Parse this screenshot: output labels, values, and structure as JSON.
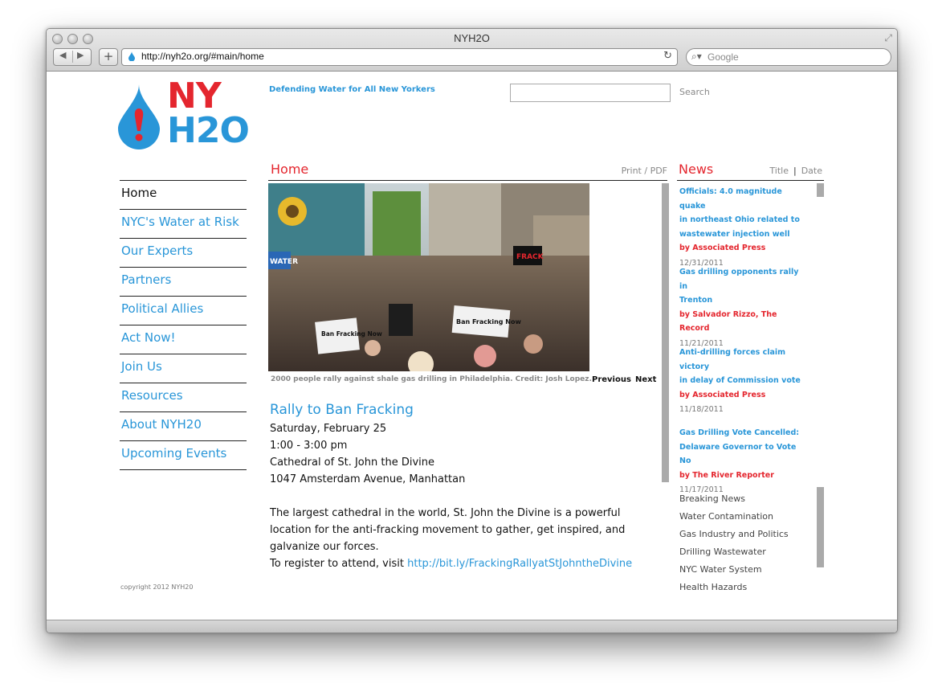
{
  "browser": {
    "window_title": "NYH2O",
    "url": "http://nyh2o.org/#main/home",
    "search_placeholder": "Google"
  },
  "site": {
    "logo_line1": "NY",
    "logo_line2": "H2O",
    "tagline": "Defending Water for All New Yorkers",
    "search_label": "Search",
    "copyright": "copyright 2012 NYH20"
  },
  "nav": {
    "items": [
      {
        "label": "Home"
      },
      {
        "label": "NYC's Water at Risk"
      },
      {
        "label": "Our Experts"
      },
      {
        "label": "Partners"
      },
      {
        "label": "Political Allies"
      },
      {
        "label": "Act Now!"
      },
      {
        "label": "Join Us"
      },
      {
        "label": "Resources"
      },
      {
        "label": "About NYH20"
      },
      {
        "label": "Upcoming Events"
      }
    ]
  },
  "main": {
    "section_title": "Home",
    "print_label": "Print / PDF",
    "photo_caption": "2000 people rally against shale gas drilling in Philadelphia. Credit: Josh Lopez.",
    "previous_label": "Previous",
    "next_label": "Next",
    "event_title": "Rally to Ban Fracking",
    "event_lines": [
      "Saturday, February 25",
      "1:00 - 3:00 pm",
      "Cathedral of St. John the Divine",
      "1047 Amsterdam Avenue, Manhattan"
    ],
    "description_lines": [
      "The largest cathedral in the world, St. John the Divine is a powerful",
      "location for the anti-fracking movement to gather, get inspired, and",
      "galvanize our forces."
    ],
    "register_text": "To register to attend, visit ",
    "register_link": "http://bit.ly/FrackingRallyatStJohntheDivine",
    "sign_texts": [
      "Ban Fracking Now",
      "Ban Fracking Now",
      "FRACK",
      "WATER"
    ]
  },
  "news": {
    "title": "News",
    "sort_title": "Title",
    "sort_sep": "|",
    "sort_date": "Date",
    "items": [
      {
        "headline_lines": [
          "Officials: 4.0 magnitude quake",
          "in northeast Ohio related to",
          "wastewater injection well"
        ],
        "byline": "by Associated Press",
        "date": "12/31/2011"
      },
      {
        "headline_lines": [
          "Gas drilling opponents rally in",
          "Trenton"
        ],
        "byline": "by Salvador Rizzo, The Record",
        "date": "11/21/2011"
      },
      {
        "headline_lines": [
          "Anti-drilling forces claim victory",
          "in delay of Commission vote"
        ],
        "byline": "by Associated Press",
        "date": "11/18/2011"
      },
      {
        "headline_lines": [
          "Gas Drilling Vote Cancelled:",
          "Delaware Governor to Vote No"
        ],
        "byline": "by The River Reporter",
        "date": "11/17/2011"
      }
    ],
    "categories": [
      "Breaking News",
      "Water Contamination",
      "Gas Industry and Politics",
      "Drilling Wastewater",
      "NYC Water System",
      "Health Hazards"
    ]
  },
  "colors": {
    "brand_red": "#e4262e",
    "brand_blue": "#2996d8",
    "scrollbar": "#aaaaaa"
  }
}
